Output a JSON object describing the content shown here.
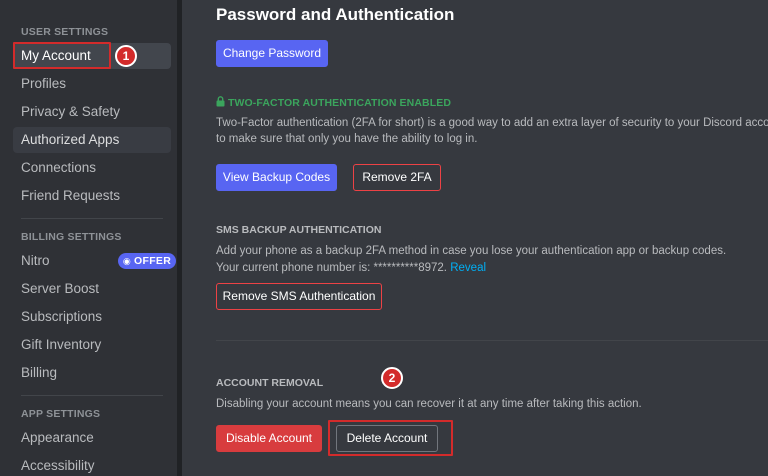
{
  "sidebar": {
    "user_settings_header": "USER SETTINGS",
    "user_items": [
      "My Account",
      "Profiles",
      "Privacy & Safety",
      "Authorized Apps",
      "Connections",
      "Friend Requests"
    ],
    "billing_settings_header": "BILLING SETTINGS",
    "nitro_label": "Nitro",
    "offer_badge": "OFFER",
    "billing_items": [
      "Server Boost",
      "Subscriptions",
      "Gift Inventory",
      "Billing"
    ],
    "app_settings_header": "APP SETTINGS",
    "app_items": [
      "Appearance",
      "Accessibility"
    ],
    "selected_item": "My Account"
  },
  "annotations": {
    "step1": "1",
    "step2": "2",
    "highlight_color": "#d32b2b"
  },
  "main": {
    "title": "Password and Authentication",
    "change_password_button": "Change Password",
    "twofa": {
      "header": "TWO-FACTOR AUTHENTICATION ENABLED",
      "description_line1": "Two-Factor authentication (2FA for short) is a good way to add an extra layer of security to your Discord account",
      "description_line2": "to make sure that only you have the ability to log in.",
      "view_backup_codes_button": "View Backup Codes",
      "remove_2fa_button": "Remove 2FA"
    },
    "sms": {
      "header": "SMS BACKUP AUTHENTICATION",
      "description": "Add your phone as a backup 2FA method in case you lose your authentication app or backup codes.",
      "phone_prefix": "Your current phone number is: **********8972.",
      "reveal_link": "Reveal",
      "remove_sms_button": "Remove SMS Authentication"
    },
    "account_removal": {
      "header": "ACCOUNT REMOVAL",
      "description": "Disabling your account means you can recover it at any time after taking this action.",
      "disable_button": "Disable Account",
      "delete_button": "Delete Account"
    }
  },
  "colors": {
    "background": "#36393f",
    "sidebar": "#2f3136",
    "blurple": "#5865f2",
    "danger": "#ed4245",
    "success": "#3ba55d",
    "link": "#00aff4"
  }
}
